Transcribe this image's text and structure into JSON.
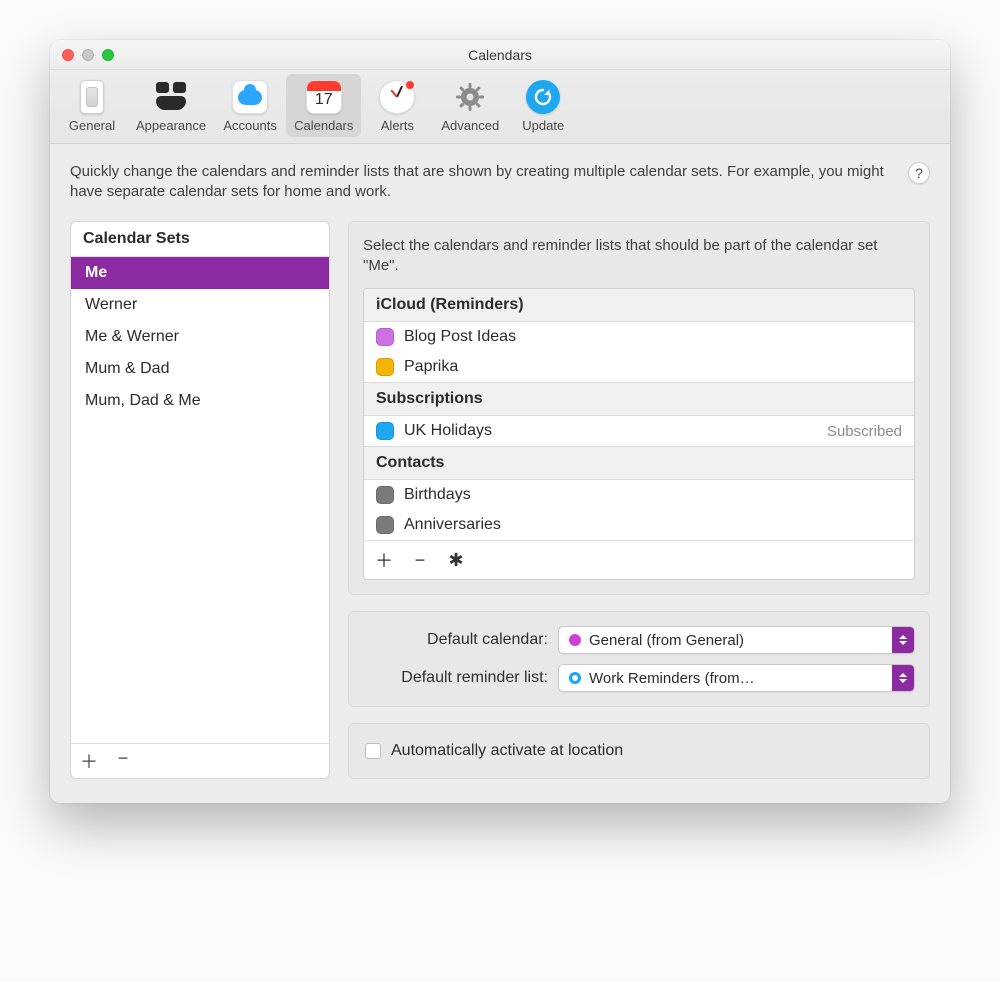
{
  "window": {
    "title": "Calendars"
  },
  "toolbar": {
    "items": [
      {
        "label": "General"
      },
      {
        "label": "Appearance"
      },
      {
        "label": "Accounts"
      },
      {
        "label": "Calendars",
        "calendar_day": "17"
      },
      {
        "label": "Alerts"
      },
      {
        "label": "Advanced"
      },
      {
        "label": "Update"
      }
    ],
    "selected_index": 3
  },
  "intro": "Quickly change the calendars and reminder lists that are shown by creating multiple calendar sets. For example, you might have separate calendar sets for home and work.",
  "help_symbol": "?",
  "sets": {
    "header": "Calendar Sets",
    "items": [
      "Me",
      "Werner",
      "Me & Werner",
      "Mum & Dad",
      "Mum, Dad & Me"
    ],
    "selected_index": 0
  },
  "right": {
    "hint": "Select the calendars and reminder lists that should be part of the calendar set \"Me\".",
    "groups": [
      {
        "title": "iCloud (Reminders)",
        "items": [
          {
            "name": "Blog Post Ideas",
            "color": "#cf6fe6"
          },
          {
            "name": "Paprika",
            "color": "#f5b400"
          }
        ]
      },
      {
        "title": "Subscriptions",
        "items": [
          {
            "name": "UK Holidays",
            "color": "#1fa7f0",
            "badge": "Subscribed"
          }
        ]
      },
      {
        "title": "Contacts",
        "items": [
          {
            "name": "Birthdays",
            "color": "#7a7a7a"
          },
          {
            "name": "Anniversaries",
            "color": "#7a7a7a"
          }
        ]
      }
    ]
  },
  "defaults": {
    "calendar_label": "Default calendar:",
    "calendar_value": "General (from General)",
    "calendar_color": "#cf3fd3",
    "reminder_label": "Default reminder list:",
    "reminder_value": "Work Reminders (from…",
    "reminder_color": "#16a6ff"
  },
  "auto_activate": {
    "label": "Automatically activate at location",
    "checked": false
  },
  "glyphs": {
    "plus": "＋",
    "minus": "−",
    "gear": "✱"
  }
}
